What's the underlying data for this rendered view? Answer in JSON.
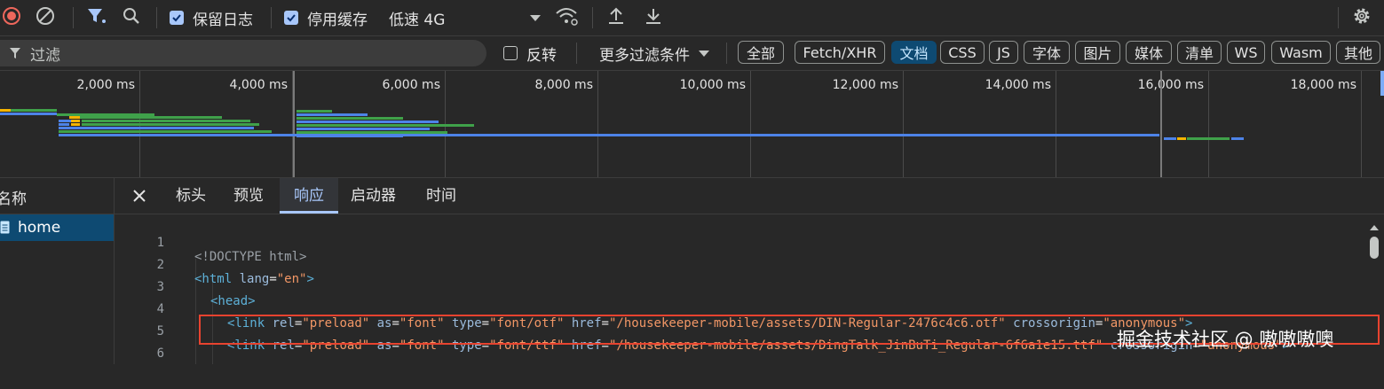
{
  "toolbar": {
    "preserve_log_label": "保留日志",
    "disable_cache_label": "停用缓存",
    "throttle_value": "低速 4G"
  },
  "filterbar": {
    "filter_placeholder": "过滤",
    "invert_label": "反转",
    "more_filters_label": "更多过滤条件",
    "type_filters": [
      {
        "label": "全部",
        "active": false
      },
      {
        "label": "Fetch/XHR",
        "active": false
      },
      {
        "label": "文档",
        "active": true
      },
      {
        "label": "CSS",
        "active": false
      },
      {
        "label": "JS",
        "active": false
      },
      {
        "label": "字体",
        "active": false
      },
      {
        "label": "图片",
        "active": false
      },
      {
        "label": "媒体",
        "active": false
      },
      {
        "label": "清单",
        "active": false
      },
      {
        "label": "WS",
        "active": false
      },
      {
        "label": "Wasm",
        "active": false
      },
      {
        "label": "其他",
        "active": false
      }
    ]
  },
  "overview": {
    "tick_labels": [
      "2,000 ms",
      "4,000 ms",
      "6,000 ms",
      "8,000 ms",
      "10,000 ms",
      "12,000 ms",
      "14,000 ms",
      "16,000 ms",
      "18,000 ms"
    ]
  },
  "requests": {
    "header": "名称",
    "items": [
      {
        "name": "home",
        "selected": true
      }
    ]
  },
  "detail_tabs": [
    {
      "label": "标头",
      "active": false
    },
    {
      "label": "预览",
      "active": false
    },
    {
      "label": "响应",
      "active": true
    },
    {
      "label": "启动器",
      "active": false
    },
    {
      "label": "时间",
      "active": false
    }
  ],
  "response_code": [
    {
      "line": "1",
      "text": "<!DOCTYPE html>"
    },
    {
      "line": "2",
      "text": "<html lang=\"en\">"
    },
    {
      "line": "3",
      "text": "<head>"
    },
    {
      "line": "4",
      "text": "<link rel=\"preload\" as=\"font\" type=\"font/otf\" href=\"/housekeeper-mobile/assets/DIN-Regular-2476c4c6.otf\" crossorigin=\"anonymous\">"
    },
    {
      "line": "5",
      "text": "<link rel=\"preload\" as=\"font\" type=\"font/ttf\" href=\"/housekeeper-mobile/assets/DingTalk_JinBuTi_Regular-6f6a1e15.ttf\" crossorigin=\"anonymous\">"
    },
    {
      "line": "6",
      "text": ""
    }
  ],
  "watermark": "掘金技术社区 @ 嗷嗷嗷噢",
  "colors": {
    "accent": "#a8c7fa",
    "highlight_box": "#e8432f",
    "waterfall_blue": "#4d83e8",
    "waterfall_green": "#3fa14a",
    "waterfall_orange": "#f5b400"
  }
}
